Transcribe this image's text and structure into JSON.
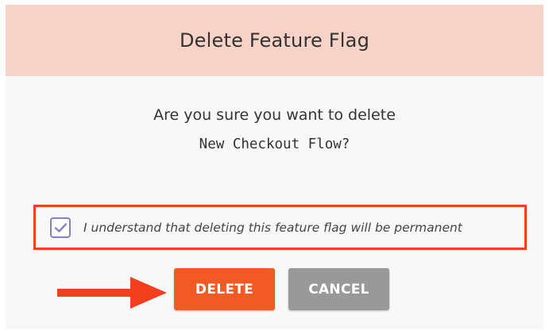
{
  "dialog": {
    "title": "Delete Feature Flag",
    "question": "Are you sure you want to delete",
    "flag_name": "New Checkout Flow?",
    "confirmation": {
      "checked": true,
      "label": "I understand that deleting this feature flag will be permanent"
    },
    "buttons": {
      "delete_label": "DELETE",
      "cancel_label": "CANCEL"
    }
  },
  "annotation": {
    "arrow_icon": "arrow-right-icon",
    "highlight_color": "#f2401f"
  },
  "colors": {
    "header_bg": "#f7d2c6",
    "delete_bg": "#f15a24",
    "cancel_bg": "#999999",
    "checkbox_accent": "#8780c9"
  }
}
